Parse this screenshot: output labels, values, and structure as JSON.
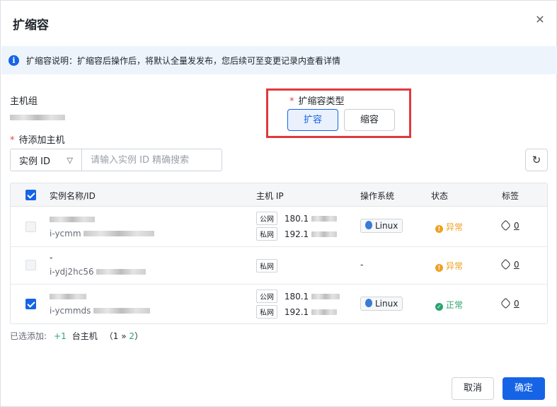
{
  "dialog": {
    "title": "扩缩容",
    "close_icon": "close-icon"
  },
  "notice": {
    "icon": "info-icon",
    "text": "扩缩容说明：扩缩容后操作后，将默认全量发发布，您后续可至变更记录内查看详情"
  },
  "host_group": {
    "label": "主机组"
  },
  "scale_type": {
    "required": "*",
    "label": "扩缩容类型",
    "scale_out": "扩容",
    "scale_in": "缩容",
    "selected": "扩容"
  },
  "pending_hosts": {
    "required": "*",
    "label": "待添加主机"
  },
  "search": {
    "select_value": "实例 ID",
    "placeholder": "请输入实例 ID 精确搜索"
  },
  "table": {
    "headers": {
      "name": "实例名称/ID",
      "ip": "主机 IP",
      "os": "操作系统",
      "status": "状态",
      "tags": "标签"
    },
    "rows": [
      {
        "name": "",
        "id": "i-ycmm",
        "public_tag": "公网",
        "public_ip": "180.1",
        "private_tag": "私网",
        "private_ip": "192.1",
        "os": "Linux",
        "status": "异常",
        "tags": "0",
        "checked": false
      },
      {
        "name": "-",
        "id": "i-ydj2hc56",
        "private_tag": "私网",
        "os": "-",
        "status": "异常",
        "tags": "0",
        "checked": false
      },
      {
        "name": "",
        "id": "i-ycmmds",
        "public_tag": "公网",
        "public_ip": "180.1",
        "private_tag": "私网",
        "private_ip": "192.1",
        "os": "Linux",
        "status": "正常",
        "tags": "0",
        "checked": true
      }
    ]
  },
  "summary": {
    "prefix": "已选添加:",
    "count": "+1",
    "unit": "台主机",
    "page_open": "（",
    "page_current": "1",
    "page_sep": "»",
    "page_total": "2",
    "page_close": "）"
  },
  "footer": {
    "cancel": "取消",
    "confirm": "确定"
  },
  "colors": {
    "primary": "#1664e6",
    "danger": "#e0393e",
    "warning": "#f0a020",
    "success": "#2ba471"
  }
}
